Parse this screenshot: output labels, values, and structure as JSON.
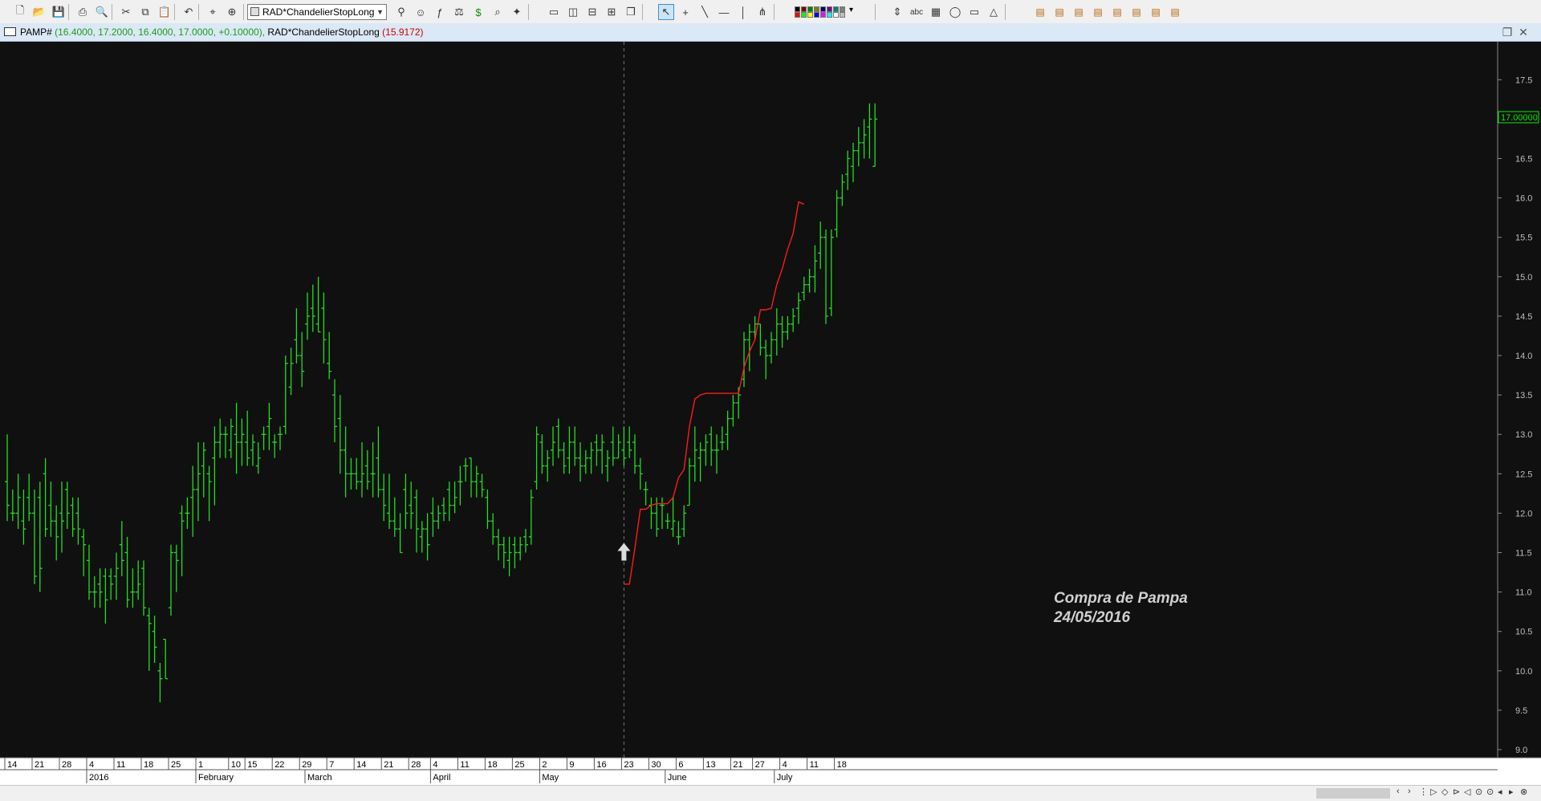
{
  "toolbar": {
    "symbol_combo": "RAD*ChandelierStopLong",
    "tools_left": [
      "new-file-icon",
      "open-folder-icon",
      "save-icon",
      "print-icon",
      "print-preview-icon",
      "cut-icon",
      "copy-icon",
      "paste-icon",
      "undo-icon",
      "crosshair-icon",
      "zoom-icon"
    ],
    "tools_mid": [
      "indicator-icon",
      "expert-icon",
      "formula-icon",
      "system-icon",
      "dollar-icon",
      "explorer-icon",
      "magic-icon"
    ],
    "layout_tools": [
      "window-new-icon",
      "tile-vertical-icon",
      "tile-horizontal-icon",
      "tile-grid-icon",
      "window-cascade-icon"
    ],
    "draw_tools": [
      "pointer-icon",
      "cross-icon",
      "trendline-icon",
      "horizontal-line-icon",
      "vertical-line-icon",
      "fork-icon"
    ],
    "misc_tools": [
      "spinner-icon",
      "text-tool-icon",
      "grid-icon",
      "ellipse-icon",
      "rectangle-icon",
      "triangle-icon"
    ],
    "right_tools": [
      "tool-a-icon",
      "tool-b-icon",
      "tool-c-icon",
      "tool-d-icon",
      "tool-e-icon",
      "tool-f-icon",
      "tool-g-icon",
      "tool-h-icon"
    ],
    "palette_colors": [
      "#000000",
      "#800000",
      "#008000",
      "#808000",
      "#000080",
      "#800080",
      "#008080",
      "#808080",
      "#ff0000",
      "#00ff00",
      "#ffff00",
      "#0000ff",
      "#ff00ff",
      "#00ffff",
      "#ffffff",
      "#c0c0c0"
    ]
  },
  "titlebar": {
    "symbol": "PAMP#",
    "ohlc": "(16.4000, 17.2000, 16.4000, 17.0000, +0.10000),",
    "indicator": "RAD*ChandelierStopLong",
    "indicator_value": "(15.9172)"
  },
  "chart_data": {
    "type": "bar",
    "style": "OHLC",
    "ylim": [
      9.0,
      17.5
    ],
    "yticks": [
      9.0,
      9.5,
      10.0,
      10.5,
      11.0,
      11.5,
      12.0,
      12.5,
      13.0,
      13.5,
      14.0,
      14.5,
      15.0,
      15.5,
      16.0,
      16.5,
      17.0,
      17.5
    ],
    "last_price_label": "17.00000",
    "grid": false,
    "colors": {
      "background": "#101010",
      "bars": "#22dd22",
      "stop_line": "#ff1a1a",
      "annotation": "#d0d0d0",
      "price_marker": "#00ee00"
    },
    "day_ticks": [
      {
        "label": "14",
        "i": 0
      },
      {
        "label": "21",
        "i": 5
      },
      {
        "label": "28",
        "i": 10
      },
      {
        "label": "4",
        "i": 15
      },
      {
        "label": "11",
        "i": 20
      },
      {
        "label": "18",
        "i": 25
      },
      {
        "label": "25",
        "i": 30
      },
      {
        "label": "1",
        "i": 35
      },
      {
        "label": "10",
        "i": 41
      },
      {
        "label": "15",
        "i": 44
      },
      {
        "label": "22",
        "i": 49
      },
      {
        "label": "29",
        "i": 54
      },
      {
        "label": "7",
        "i": 59
      },
      {
        "label": "14",
        "i": 64
      },
      {
        "label": "21",
        "i": 69
      },
      {
        "label": "28",
        "i": 74
      },
      {
        "label": "4",
        "i": 78
      },
      {
        "label": "11",
        "i": 83
      },
      {
        "label": "18",
        "i": 88
      },
      {
        "label": "25",
        "i": 93
      },
      {
        "label": "2",
        "i": 98
      },
      {
        "label": "9",
        "i": 103
      },
      {
        "label": "16",
        "i": 108
      },
      {
        "label": "23",
        "i": 113
      },
      {
        "label": "30",
        "i": 118
      },
      {
        "label": "6",
        "i": 123
      },
      {
        "label": "13",
        "i": 128
      },
      {
        "label": "21",
        "i": 133
      },
      {
        "label": "27",
        "i": 137
      },
      {
        "label": "4",
        "i": 142
      },
      {
        "label": "11",
        "i": 147
      },
      {
        "label": "18",
        "i": 152
      }
    ],
    "month_labels": [
      {
        "label": "2016",
        "i": 15
      },
      {
        "label": "February",
        "i": 35
      },
      {
        "label": "March",
        "i": 55
      },
      {
        "label": "April",
        "i": 78
      },
      {
        "label": "May",
        "i": 98
      },
      {
        "label": "June",
        "i": 121
      },
      {
        "label": "July",
        "i": 141
      }
    ],
    "marker_index": 113,
    "annotation": {
      "line1": "Compra de Pampa",
      "line2": "24/05/2016"
    },
    "ohlc": [
      [
        12.4,
        13.0,
        11.9,
        12.1
      ],
      [
        12.0,
        12.3,
        11.9,
        12.0
      ],
      [
        12.0,
        12.5,
        11.8,
        12.2
      ],
      [
        11.9,
        12.3,
        11.6,
        11.8
      ],
      [
        12.2,
        12.5,
        11.9,
        12.0
      ],
      [
        12.0,
        12.3,
        11.1,
        11.2
      ],
      [
        12.2,
        12.4,
        11.0,
        11.3
      ],
      [
        12.5,
        12.7,
        11.7,
        11.8
      ],
      [
        12.1,
        12.4,
        11.7,
        11.9
      ],
      [
        11.9,
        12.1,
        11.4,
        11.7
      ],
      [
        12.0,
        12.4,
        11.5,
        11.9
      ],
      [
        12.3,
        12.4,
        11.8,
        12.0
      ],
      [
        12.1,
        12.2,
        11.7,
        11.8
      ],
      [
        12.0,
        12.2,
        11.6,
        11.8
      ],
      [
        11.7,
        11.8,
        11.2,
        11.6
      ],
      [
        11.4,
        11.6,
        10.9,
        11.0
      ],
      [
        11.0,
        11.2,
        10.8,
        11.0
      ],
      [
        11.1,
        11.3,
        10.8,
        11.0
      ],
      [
        11.2,
        11.3,
        10.6,
        10.9
      ],
      [
        11.2,
        11.3,
        10.9,
        11.1
      ],
      [
        11.2,
        11.5,
        10.9,
        11.3
      ],
      [
        11.6,
        11.9,
        11.2,
        11.4
      ],
      [
        11.5,
        11.7,
        10.8,
        10.9
      ],
      [
        11.0,
        11.3,
        10.8,
        11.0
      ],
      [
        11.0,
        11.4,
        10.9,
        11.1
      ],
      [
        11.3,
        11.4,
        10.7,
        10.8
      ],
      [
        10.7,
        10.8,
        10.0,
        10.6
      ],
      [
        10.5,
        10.7,
        10.1,
        10.3
      ],
      [
        10.0,
        10.1,
        9.6,
        9.9
      ],
      [
        10.4,
        10.4,
        9.9,
        9.9
      ],
      [
        10.8,
        11.6,
        10.7,
        11.5
      ],
      [
        11.5,
        11.6,
        11.0,
        11.4
      ],
      [
        12.0,
        12.1,
        11.2,
        11.9
      ],
      [
        12.0,
        12.2,
        11.8,
        12.0
      ],
      [
        12.2,
        12.6,
        11.7,
        12.3
      ],
      [
        12.3,
        12.9,
        11.9,
        12.5
      ],
      [
        12.6,
        12.9,
        12.2,
        12.8
      ],
      [
        12.5,
        12.6,
        11.9,
        12.4
      ],
      [
        12.7,
        13.1,
        12.1,
        12.9
      ],
      [
        12.9,
        13.2,
        12.7,
        13.0
      ],
      [
        13.0,
        13.1,
        12.7,
        13.0
      ],
      [
        12.8,
        13.2,
        12.7,
        13.1
      ],
      [
        13.0,
        13.4,
        12.5,
        12.9
      ],
      [
        12.9,
        13.2,
        12.6,
        13.0
      ],
      [
        12.9,
        13.3,
        12.6,
        12.7
      ],
      [
        12.8,
        13.0,
        12.6,
        12.9
      ],
      [
        12.6,
        12.9,
        12.5,
        12.7
      ],
      [
        13.0,
        13.1,
        12.8,
        13.0
      ],
      [
        13.1,
        13.4,
        12.8,
        13.2
      ],
      [
        12.9,
        13.0,
        12.7,
        12.9
      ],
      [
        13.0,
        13.1,
        12.8,
        13.0
      ],
      [
        13.1,
        14.0,
        13.0,
        13.9
      ],
      [
        13.6,
        14.1,
        13.5,
        13.9
      ],
      [
        14.2,
        14.6,
        13.9,
        14.0
      ],
      [
        14.0,
        14.3,
        13.6,
        13.8
      ],
      [
        14.4,
        14.8,
        14.2,
        14.5
      ],
      [
        14.6,
        14.9,
        14.3,
        14.5
      ],
      [
        14.4,
        15.0,
        14.3,
        14.3
      ],
      [
        14.6,
        14.8,
        13.9,
        14.2
      ],
      [
        13.9,
        14.3,
        13.7,
        13.8
      ],
      [
        13.5,
        13.7,
        12.9,
        13.1
      ],
      [
        13.2,
        13.5,
        12.5,
        12.8
      ],
      [
        12.8,
        13.1,
        12.2,
        12.5
      ],
      [
        12.5,
        12.7,
        12.3,
        12.5
      ],
      [
        12.5,
        12.7,
        12.3,
        12.4
      ],
      [
        12.4,
        12.9,
        12.2,
        12.5
      ],
      [
        12.6,
        12.8,
        12.3,
        12.4
      ],
      [
        12.5,
        12.9,
        12.2,
        12.5
      ],
      [
        12.7,
        13.1,
        12.2,
        12.3
      ],
      [
        12.3,
        12.5,
        11.9,
        12.1
      ],
      [
        12.0,
        12.5,
        11.8,
        11.9
      ],
      [
        11.9,
        12.2,
        11.7,
        11.8
      ],
      [
        11.8,
        12.0,
        11.5,
        11.5
      ],
      [
        12.3,
        12.5,
        11.8,
        12.0
      ],
      [
        12.1,
        12.4,
        11.8,
        12.0
      ],
      [
        12.2,
        12.3,
        11.5,
        11.8
      ],
      [
        11.7,
        11.9,
        11.5,
        11.8
      ],
      [
        11.8,
        12.0,
        11.4,
        11.6
      ],
      [
        12.0,
        12.2,
        11.7,
        11.9
      ],
      [
        11.9,
        12.1,
        11.8,
        12.0
      ],
      [
        12.1,
        12.2,
        11.9,
        12.0
      ],
      [
        12.3,
        12.4,
        11.9,
        12.1
      ],
      [
        12.1,
        12.4,
        12.0,
        12.2
      ],
      [
        12.4,
        12.6,
        12.1,
        12.4
      ],
      [
        12.6,
        12.7,
        12.4,
        12.6
      ],
      [
        12.7,
        12.7,
        12.2,
        12.4
      ],
      [
        12.4,
        12.6,
        12.2,
        12.5
      ],
      [
        12.4,
        12.5,
        12.2,
        12.3
      ],
      [
        12.2,
        12.3,
        11.8,
        11.9
      ],
      [
        11.9,
        12.0,
        11.6,
        11.7
      ],
      [
        11.7,
        11.8,
        11.4,
        11.6
      ],
      [
        11.6,
        11.7,
        11.3,
        11.5
      ],
      [
        11.4,
        11.7,
        11.2,
        11.5
      ],
      [
        11.6,
        11.7,
        11.3,
        11.5
      ],
      [
        11.5,
        11.7,
        11.4,
        11.6
      ],
      [
        11.7,
        11.8,
        11.5,
        11.6
      ],
      [
        11.7,
        12.3,
        11.6,
        12.2
      ],
      [
        12.4,
        13.1,
        12.3,
        13.0
      ],
      [
        12.9,
        13.0,
        12.5,
        12.6
      ],
      [
        12.6,
        12.8,
        12.4,
        12.7
      ],
      [
        12.8,
        13.1,
        12.6,
        12.9
      ],
      [
        13.1,
        13.2,
        12.7,
        12.8
      ],
      [
        12.8,
        12.9,
        12.5,
        12.6
      ],
      [
        12.7,
        13.1,
        12.5,
        12.9
      ],
      [
        12.9,
        13.1,
        12.6,
        12.7
      ],
      [
        12.7,
        12.9,
        12.4,
        12.6
      ],
      [
        12.6,
        12.8,
        12.5,
        12.7
      ],
      [
        12.7,
        12.9,
        12.5,
        12.8
      ],
      [
        12.9,
        13.0,
        12.6,
        12.8
      ],
      [
        12.8,
        13.0,
        12.5,
        12.9
      ],
      [
        12.6,
        12.8,
        12.4,
        12.7
      ],
      [
        12.9,
        13.1,
        12.6,
        12.7
      ],
      [
        12.7,
        13.0,
        12.7,
        12.9
      ],
      [
        12.8,
        13.1,
        12.6,
        12.7
      ],
      [
        12.9,
        13.1,
        12.7,
        12.8
      ],
      [
        12.9,
        13.0,
        12.5,
        12.6
      ],
      [
        12.6,
        12.7,
        12.3,
        12.5
      ],
      [
        12.3,
        12.4,
        12.1,
        12.3
      ],
      [
        12.1,
        12.2,
        11.8,
        12.0
      ],
      [
        12.0,
        12.2,
        11.7,
        11.8
      ],
      [
        12.1,
        12.2,
        11.8,
        12.1
      ],
      [
        11.9,
        12.0,
        11.8,
        11.9
      ],
      [
        11.8,
        12.2,
        11.7,
        11.9
      ],
      [
        11.7,
        11.9,
        11.6,
        11.7
      ],
      [
        11.8,
        12.1,
        11.7,
        12.0
      ],
      [
        12.1,
        12.7,
        12.1,
        12.6
      ],
      [
        12.6,
        13.1,
        12.4,
        12.8
      ],
      [
        12.7,
        12.9,
        12.4,
        12.8
      ],
      [
        12.8,
        13.0,
        12.6,
        12.9
      ],
      [
        13.0,
        13.1,
        12.6,
        12.8
      ],
      [
        12.8,
        13.0,
        12.5,
        12.8
      ],
      [
        12.9,
        13.1,
        12.8,
        12.9
      ],
      [
        13.0,
        13.3,
        12.8,
        13.2
      ],
      [
        13.2,
        13.5,
        13.1,
        13.4
      ],
      [
        13.4,
        13.6,
        13.2,
        13.5
      ],
      [
        13.7,
        14.3,
        13.6,
        14.2
      ],
      [
        14.2,
        14.4,
        13.8,
        14.3
      ],
      [
        14.3,
        14.5,
        14.2,
        14.4
      ],
      [
        14.4,
        14.4,
        14.0,
        14.1
      ],
      [
        14.1,
        14.2,
        13.7,
        14.0
      ],
      [
        14.0,
        14.3,
        13.9,
        14.2
      ],
      [
        14.2,
        14.6,
        14.0,
        14.4
      ],
      [
        14.4,
        14.5,
        14.1,
        14.3
      ],
      [
        14.3,
        14.5,
        14.2,
        14.4
      ],
      [
        14.4,
        14.6,
        14.3,
        14.5
      ],
      [
        14.6,
        14.8,
        14.4,
        14.7
      ],
      [
        14.8,
        15.0,
        14.7,
        14.9
      ],
      [
        14.9,
        15.1,
        14.8,
        15.0
      ],
      [
        15.0,
        15.4,
        14.8,
        15.2
      ],
      [
        15.3,
        15.7,
        15.1,
        15.5
      ],
      [
        15.5,
        15.6,
        14.4,
        14.5
      ],
      [
        14.6,
        15.6,
        14.5,
        15.5
      ],
      [
        15.6,
        16.1,
        15.5,
        16.0
      ],
      [
        16.0,
        16.3,
        15.9,
        16.2
      ],
      [
        16.3,
        16.6,
        16.1,
        16.5
      ],
      [
        16.4,
        16.7,
        16.2,
        16.6
      ],
      [
        16.6,
        16.9,
        16.4,
        16.7
      ],
      [
        16.7,
        17.0,
        16.5,
        16.8
      ],
      [
        16.9,
        17.2,
        16.5,
        17.0
      ],
      [
        16.4,
        17.2,
        16.4,
        17.0
      ]
    ],
    "stop": [
      [
        113,
        11.1
      ],
      [
        114,
        11.1
      ],
      [
        115,
        11.55
      ],
      [
        116,
        12.05
      ],
      [
        117,
        12.05
      ],
      [
        118,
        12.1
      ],
      [
        119,
        12.12
      ],
      [
        120,
        12.12
      ],
      [
        121,
        12.12
      ],
      [
        122,
        12.2
      ],
      [
        123,
        12.45
      ],
      [
        124,
        12.55
      ],
      [
        125,
        13.1
      ],
      [
        126,
        13.45
      ],
      [
        127,
        13.5
      ],
      [
        128,
        13.52
      ],
      [
        129,
        13.52
      ],
      [
        130,
        13.52
      ],
      [
        131,
        13.52
      ],
      [
        132,
        13.52
      ],
      [
        133,
        13.52
      ],
      [
        134,
        13.52
      ],
      [
        135,
        13.85
      ],
      [
        136,
        14.05
      ],
      [
        137,
        14.2
      ],
      [
        138,
        14.58
      ],
      [
        139,
        14.58
      ],
      [
        140,
        14.6
      ],
      [
        141,
        14.9
      ],
      [
        142,
        15.1
      ],
      [
        143,
        15.35
      ],
      [
        144,
        15.55
      ],
      [
        145,
        15.95
      ],
      [
        146,
        15.92
      ]
    ]
  },
  "bottom": {
    "nav_glyphs": [
      "‹",
      "›",
      "⋮",
      "▷",
      "◇",
      "⊳",
      "◁",
      "⊙",
      "⊙",
      "◂",
      "▸",
      "⊗"
    ]
  }
}
